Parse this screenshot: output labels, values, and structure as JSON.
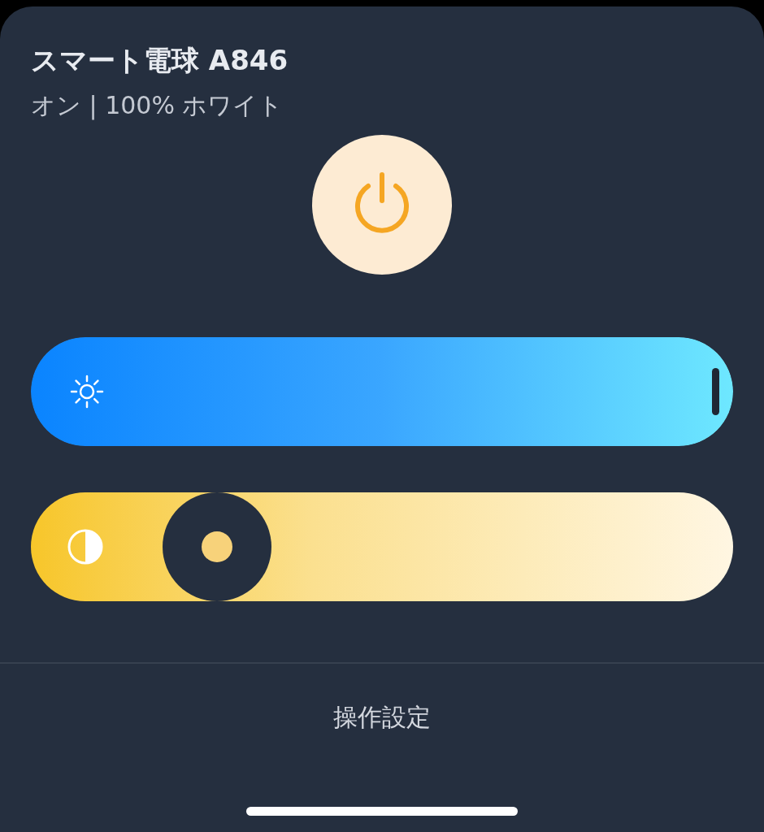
{
  "device": {
    "title": "スマート電球 A846",
    "status": "オン | 100% ホワイト"
  },
  "power": {
    "on": true
  },
  "sliders": [
    {
      "kind": "brightness",
      "level": 1.0
    },
    {
      "kind": "temperature"
    }
  ],
  "footer": {
    "label": "操作設定"
  }
}
